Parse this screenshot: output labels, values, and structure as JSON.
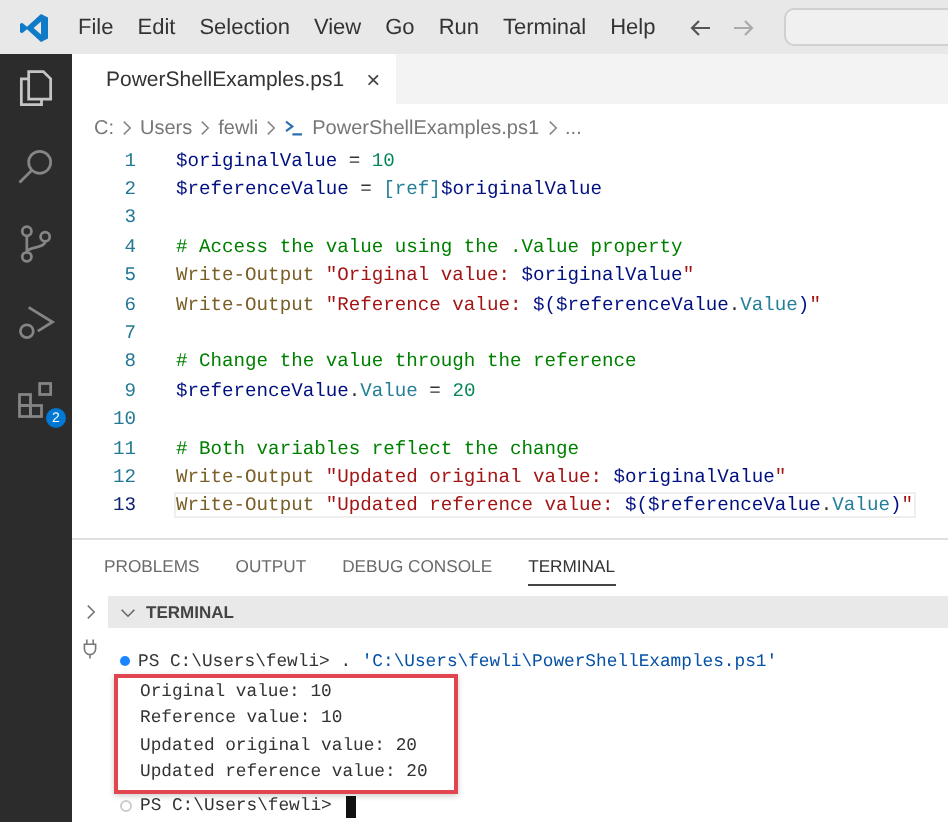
{
  "menu_bar": {
    "items": [
      "File",
      "Edit",
      "Selection",
      "View",
      "Go",
      "Run",
      "Terminal",
      "Help"
    ]
  },
  "activity_bar": {
    "items": [
      {
        "kind": "explorer"
      },
      {
        "kind": "search"
      },
      {
        "kind": "source-control"
      },
      {
        "kind": "run-debug"
      },
      {
        "kind": "extensions",
        "badge": "2"
      }
    ]
  },
  "editor": {
    "tab": {
      "label": "PowerShellExamples.ps1",
      "close": "×"
    },
    "breadcrumbs": [
      "C:",
      "Users",
      "fewli",
      "PowerShellExamples.ps1",
      "..."
    ],
    "lines": [
      {
        "number": "1",
        "tokens": [
          {
            "kind": "var",
            "text": "$originalValue"
          },
          {
            "kind": "op",
            "text": " = "
          },
          {
            "kind": "num",
            "text": "10"
          }
        ]
      },
      {
        "number": "2",
        "tokens": [
          {
            "kind": "var",
            "text": "$referenceValue"
          },
          {
            "kind": "op",
            "text": " = "
          },
          {
            "kind": "type",
            "text": "[ref]"
          },
          {
            "kind": "var",
            "text": "$originalValue"
          }
        ]
      },
      {
        "number": "3"
      },
      {
        "number": "4",
        "tokens": [
          {
            "kind": "comment",
            "text": "# Access the value using the .Value property"
          }
        ]
      },
      {
        "number": "5",
        "tokens": [
          {
            "kind": "cmd",
            "text": "Write-Output "
          },
          {
            "kind": "str",
            "text": "\"Original value: "
          },
          {
            "kind": "var",
            "text": "$originalValue"
          },
          {
            "kind": "str",
            "text": "\""
          }
        ]
      },
      {
        "number": "6",
        "tokens": [
          {
            "kind": "cmd",
            "text": "Write-Output "
          },
          {
            "kind": "str",
            "text": "\"Reference value: "
          },
          {
            "kind": "var",
            "text": "$($referenceValue"
          },
          {
            "kind": "op",
            "text": "."
          },
          {
            "kind": "prop",
            "text": "Value"
          },
          {
            "kind": "var",
            "text": ")"
          },
          {
            "kind": "str",
            "text": "\""
          }
        ]
      },
      {
        "number": "7"
      },
      {
        "number": "8",
        "tokens": [
          {
            "kind": "comment",
            "text": "# Change the value through the reference"
          }
        ]
      },
      {
        "number": "9",
        "tokens": [
          {
            "kind": "var",
            "text": "$referenceValue"
          },
          {
            "kind": "op",
            "text": "."
          },
          {
            "kind": "prop",
            "text": "Value"
          },
          {
            "kind": "op",
            "text": " = "
          },
          {
            "kind": "num",
            "text": "20"
          }
        ]
      },
      {
        "number": "10"
      },
      {
        "number": "11",
        "tokens": [
          {
            "kind": "comment",
            "text": "# Both variables reflect the change"
          }
        ]
      },
      {
        "number": "12",
        "tokens": [
          {
            "kind": "cmd",
            "text": "Write-Output "
          },
          {
            "kind": "str",
            "text": "\"Updated original value: "
          },
          {
            "kind": "var",
            "text": "$originalValue"
          },
          {
            "kind": "str",
            "text": "\""
          }
        ]
      },
      {
        "number": "13",
        "current": true,
        "tokens": [
          {
            "kind": "cmd",
            "text": "Write-Output "
          },
          {
            "kind": "str",
            "text": "\"Updated reference value: "
          },
          {
            "kind": "var",
            "text": "$($referenceValue"
          },
          {
            "kind": "op",
            "text": "."
          },
          {
            "kind": "prop",
            "text": "Value"
          },
          {
            "kind": "var",
            "text": ")"
          },
          {
            "kind": "str",
            "text": "\""
          }
        ]
      }
    ]
  },
  "panel": {
    "tabs": [
      {
        "label": "PROBLEMS",
        "selected": false
      },
      {
        "label": "OUTPUT",
        "selected": false
      },
      {
        "label": "DEBUG CONSOLE",
        "selected": false
      },
      {
        "label": "TERMINAL",
        "selected": true
      }
    ],
    "terminal": {
      "header": "TERMINAL",
      "command": {
        "prompt": "PS C:\\Users\\fewli>",
        "text": " . ",
        "path": "'C:\\Users\\fewli\\PowerShellExamples.ps1'"
      },
      "output": [
        "Original value: 10",
        "Reference value: 10",
        "Updated original value: 20",
        "Updated reference value: 20"
      ],
      "prompt": "PS C:\\Users\\fewli>"
    }
  }
}
